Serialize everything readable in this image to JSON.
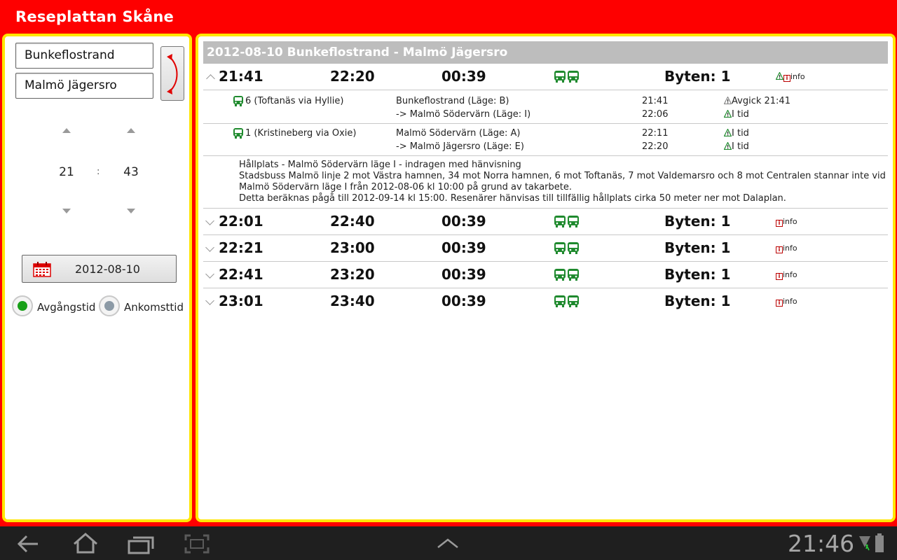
{
  "app": {
    "title": "Reseplattan Skåne"
  },
  "search": {
    "from": "Bunkeflostrand",
    "to": "Malmö Jägersro"
  },
  "time": {
    "hour": "21",
    "separator": ":",
    "minute": "43"
  },
  "date": {
    "value": "2012-08-10"
  },
  "mode": {
    "options": [
      "Avgångstid",
      "Ankomsttid"
    ],
    "selected": "Avgångstid"
  },
  "results": {
    "header": "2012-08-10  Bunkeflostrand - Malmö Jägersro",
    "trips": [
      {
        "dep": "21:41",
        "arr": "22:20",
        "dur": "00:39",
        "changes": "Byten: 1",
        "info": "info",
        "expanded": true,
        "warning": true
      },
      {
        "dep": "22:01",
        "arr": "22:40",
        "dur": "00:39",
        "changes": "Byten: 1",
        "info": "info",
        "expanded": false,
        "warning": false
      },
      {
        "dep": "22:21",
        "arr": "23:00",
        "dur": "00:39",
        "changes": "Byten: 1",
        "info": "info",
        "expanded": false,
        "warning": false
      },
      {
        "dep": "22:41",
        "arr": "23:20",
        "dur": "00:39",
        "changes": "Byten: 1",
        "info": "info",
        "expanded": false,
        "warning": false
      },
      {
        "dep": "23:01",
        "arr": "23:40",
        "dur": "00:39",
        "changes": "Byten: 1",
        "info": "info",
        "expanded": false,
        "warning": false
      }
    ],
    "legs": [
      {
        "line": "6 (Toftanäs via Hyllie)",
        "from": "Bunkeflostrand (Läge: B)",
        "to": "-> Malmö Södervärn (Läge: I)",
        "dep": "21:41",
        "arr": "22:06",
        "dep_status": "Avgick 21:41",
        "arr_status": "I tid"
      },
      {
        "line": "1 (Kristineberg via Oxie)",
        "from": "Malmö Södervärn (Läge: A)",
        "to": "-> Malmö Jägersro (Läge: E)",
        "dep": "22:11",
        "arr": "22:20",
        "dep_status": "I tid",
        "arr_status": "I tid"
      }
    ],
    "notice": [
      "Hållplats - Malmö Södervärn läge I - indragen med hänvisning",
      "Stadsbuss Malmö linje 2 mot Västra hamnen, 34 mot Norra hamnen, 6 mot Toftanäs, 7 mot Valdemarsro och 8 mot Centralen stannar inte vid",
      "Malmö Södervärn läge I från 2012-08-06 kl 10:00 på grund av takarbete.",
      "Detta beräknas pågå till 2012-09-14 kl 15:00. Resenärer hänvisas till tillfällig hållplats cirka 50 meter ner mot Dalaplan."
    ]
  },
  "statusbar": {
    "clock": "21:46"
  },
  "colors": {
    "brand": "#fe0000",
    "frame": "#ffe600",
    "bus": "#1f8a2e",
    "header_bg": "#bdbdbd",
    "radio_on": "#18a018"
  }
}
